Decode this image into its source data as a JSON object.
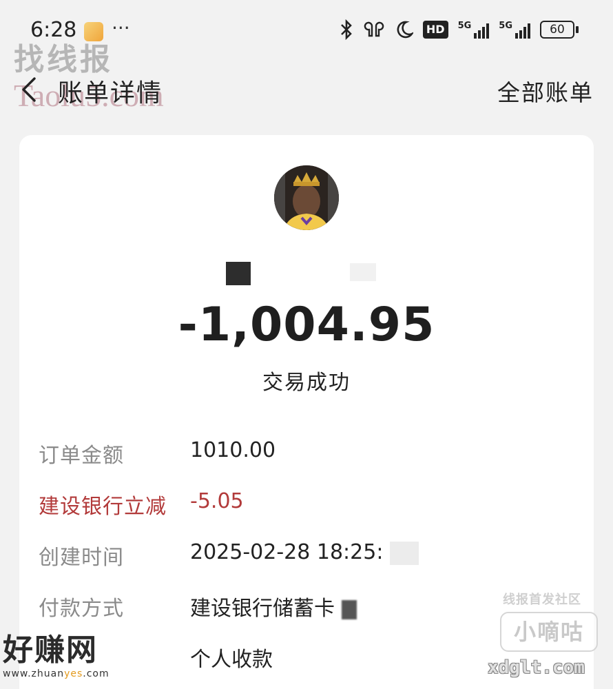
{
  "status_bar": {
    "time": "6:28",
    "more": "···",
    "hd_label": "HD",
    "net1": "5G",
    "net2": "5G",
    "battery": "60"
  },
  "watermarks": {
    "top_brand": "找线报",
    "top_url": "Taolu5.com",
    "bottom_left_brand": "好赚网",
    "bottom_left_url_prefix": "www.zhuan",
    "bottom_left_url_accent": "yes",
    "bottom_left_url_suffix": ".com",
    "community": "线报首发社区",
    "xdg_name": "小嘀咕",
    "xdg_url": "xdglt.com"
  },
  "nav": {
    "title": "账单详情",
    "right_link": "全部账单"
  },
  "transaction": {
    "amount": "-1,004.95",
    "status": "交易成功"
  },
  "details": [
    {
      "label": "订单金额",
      "value": "1010.00"
    },
    {
      "label": "建设银行立减",
      "value": "-5.05"
    },
    {
      "label": "创建时间",
      "value": "2025-02-28 18:25:"
    },
    {
      "label": "付款方式",
      "value": "建设银行储蓄卡"
    },
    {
      "label": "",
      "value": "个人收款"
    }
  ],
  "colors": {
    "discount": "#b23a3a",
    "label_gray": "#8a8a8a",
    "background": "#f2f2f2",
    "card": "#ffffff"
  }
}
